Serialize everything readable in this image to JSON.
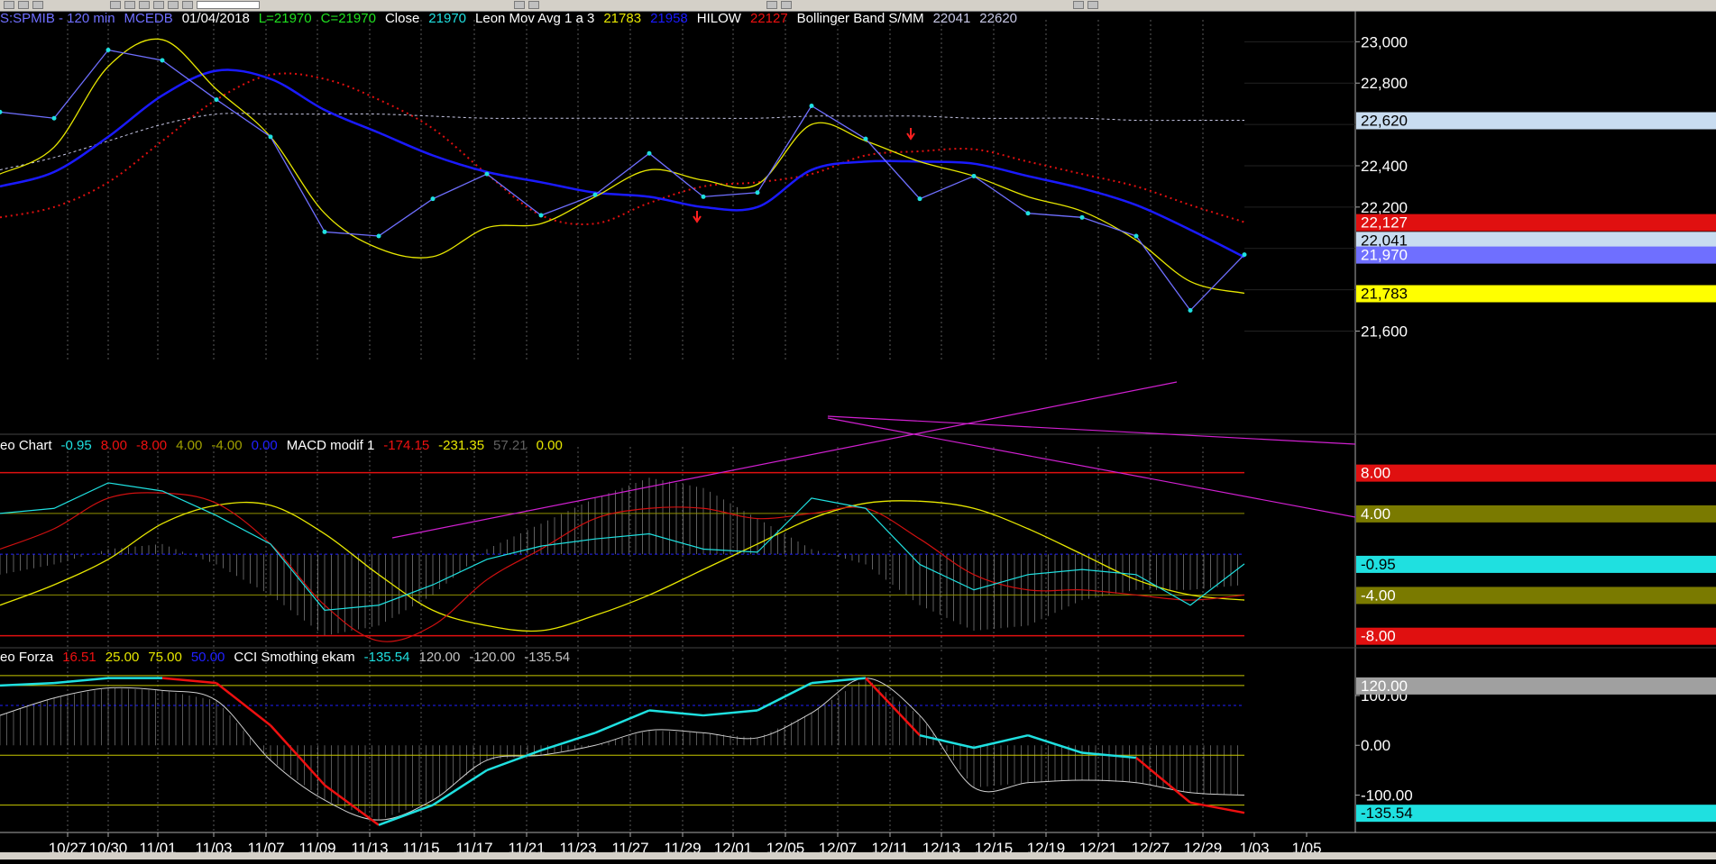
{
  "colors": {
    "grid": "#5a5a5a",
    "close": "#6f6fff",
    "close_dots": "#1fe0e0",
    "mov_avg_yellow": "#e6e600",
    "mov_avg_blue": "#1a1aff",
    "hilow_red": "#e01010",
    "hilow_green": "#14c814",
    "bollinger": "#c8c8e6",
    "macd_cyan": "#1fe0e0",
    "macd_red": "#d01010",
    "macd_yellow": "#e6e600",
    "magenta": "#d020d0",
    "histogram": "#a0a0a0",
    "cci_cyan": "#1fe0e0",
    "cci_red": "#ee1010",
    "cci_white": "#d0d0d0"
  },
  "panel1": {
    "header": [
      {
        "text": "S:SPMIB - 120 min",
        "color": "#6f6fff"
      },
      {
        "text": "MCEDB",
        "color": "#6f6fff"
      },
      {
        "text": "01/04/2018",
        "color": "#ffffff"
      },
      {
        "text": "L=21970",
        "color": "#20e020"
      },
      {
        "text": "C=21970",
        "color": "#20e020"
      },
      {
        "text": "Close",
        "color": "#ffffff"
      },
      {
        "text": "21970",
        "color": "#1fe0e0"
      },
      {
        "text": "Leon Mov Avg 1 a 3",
        "color": "#ffffff"
      },
      {
        "text": "21783",
        "color": "#e6e600"
      },
      {
        "text": "21958",
        "color": "#1a1aff"
      },
      {
        "text": "HILOW",
        "color": "#ffffff"
      },
      {
        "text": "22127",
        "color": "#ee1010"
      },
      {
        "text": "Bollinger Band S/MM",
        "color": "#ffffff"
      },
      {
        "text": "22041",
        "color": "#c8c8e6"
      },
      {
        "text": "22620",
        "color": "#c8c8e6"
      }
    ],
    "y_ticks": [
      "23,000",
      "22,800",
      "22,400",
      "22,200",
      "21,600"
    ],
    "value_tags": [
      {
        "text": "22,620",
        "bg": "#c8dcf0",
        "fg": "#000000"
      },
      {
        "text": "22,127",
        "bg": "#e01010",
        "fg": "#ffffff"
      },
      {
        "text": "22,041",
        "bg": "#c8dcf0",
        "fg": "#000000"
      },
      {
        "text": "21,970",
        "bg": "#6f6fff",
        "fg": "#ffffff"
      },
      {
        "text": "21,783",
        "bg": "#ffff00",
        "fg": "#000000"
      }
    ]
  },
  "panel2": {
    "header": [
      {
        "text": "eo Chart",
        "color": "#ffffff"
      },
      {
        "text": "-0.95",
        "color": "#1fe0e0"
      },
      {
        "text": "8.00",
        "color": "#ee1010"
      },
      {
        "text": "-8.00",
        "color": "#ee1010"
      },
      {
        "text": "4.00",
        "color": "#a0a000"
      },
      {
        "text": "-4.00",
        "color": "#a0a000"
      },
      {
        "text": "0.00",
        "color": "#2020ff"
      },
      {
        "text": "MACD modif 1",
        "color": "#ffffff"
      },
      {
        "text": "-174.15",
        "color": "#ee1010"
      },
      {
        "text": "-231.35",
        "color": "#e6e600"
      },
      {
        "text": "57.21",
        "color": "#606060"
      },
      {
        "text": "0.00",
        "color": "#e6e600"
      }
    ],
    "value_tags": [
      {
        "text": "8.00",
        "bg": "#e01010",
        "fg": "#ffffff"
      },
      {
        "text": "4.00",
        "bg": "#7a7a00",
        "fg": "#ffffff"
      },
      {
        "text": "-0.95",
        "bg": "#1fe0e0",
        "fg": "#000000"
      },
      {
        "text": "-4.00",
        "bg": "#7a7a00",
        "fg": "#ffffff"
      },
      {
        "text": "-8.00",
        "bg": "#e01010",
        "fg": "#ffffff"
      }
    ]
  },
  "panel3": {
    "header": [
      {
        "text": "eo Forza",
        "color": "#ffffff"
      },
      {
        "text": "16.51",
        "color": "#ee1010"
      },
      {
        "text": "25.00",
        "color": "#e6e600"
      },
      {
        "text": "75.00",
        "color": "#e6e600"
      },
      {
        "text": "50.00",
        "color": "#2020ff"
      },
      {
        "text": "CCI Smothing ekam",
        "color": "#ffffff"
      },
      {
        "text": "-135.54",
        "color": "#1fe0e0"
      },
      {
        "text": "120.00",
        "color": "#c0c0c0"
      },
      {
        "text": "-120.00",
        "color": "#c0c0c0"
      },
      {
        "text": "-135.54",
        "color": "#c0c0c0"
      }
    ],
    "y_ticks": [
      "100.00",
      "0.00",
      "-100.00"
    ],
    "value_tags": [
      {
        "text": "120.00",
        "bg": "#a0a0a0",
        "fg": "#ffffff"
      },
      {
        "text": "-135.54",
        "bg": "#1fe0e0",
        "fg": "#000000"
      }
    ]
  },
  "x_labels": [
    "10/27",
    "10/30",
    "11/01",
    "11/03",
    "11/07",
    "11/09",
    "11/13",
    "11/15",
    "11/17",
    "11/21",
    "11/23",
    "11/27",
    "11/29",
    "12/01",
    "12/05",
    "12/07",
    "12/11",
    "12/13",
    "12/15",
    "12/19",
    "12/21",
    "12/27",
    "12/29",
    "1/03",
    "1/05"
  ],
  "chart_data": [
    {
      "type": "line",
      "title": "S:SPMIB - 120 min",
      "categories": [
        "10/27",
        "10/30",
        "11/01",
        "11/03",
        "11/07",
        "11/09",
        "11/13",
        "11/15",
        "11/17",
        "11/21",
        "11/23",
        "11/27",
        "11/29",
        "12/01",
        "12/05",
        "12/07",
        "12/11",
        "12/13",
        "12/15",
        "12/19",
        "12/21",
        "12/27",
        "12/29",
        "1/03"
      ],
      "ylim": [
        21480,
        23080
      ],
      "series": [
        {
          "name": "Close",
          "values": [
            22660,
            22630,
            22960,
            22910,
            22720,
            22540,
            22080,
            22060,
            22240,
            22360,
            22160,
            22260,
            22460,
            22250,
            22270,
            22690,
            22530,
            22240,
            22350,
            22170,
            22150,
            22060,
            21700,
            21970
          ]
        },
        {
          "name": "Leon Mov Avg 1 a 3",
          "values": [
            22360,
            22490,
            22880,
            23010,
            22770,
            22540,
            22170,
            22000,
            21960,
            22100,
            22120,
            22250,
            22380,
            22330,
            22310,
            22600,
            22520,
            22420,
            22350,
            22250,
            22180,
            22040,
            21840,
            21783
          ]
        },
        {
          "name": "21958",
          "values": [
            22300,
            22370,
            22540,
            22740,
            22860,
            22820,
            22670,
            22560,
            22450,
            22370,
            22320,
            22270,
            22250,
            22200,
            22200,
            22380,
            22420,
            22420,
            22410,
            22350,
            22290,
            22210,
            22090,
            21958
          ]
        },
        {
          "name": "HILOW",
          "values": [
            22150,
            22200,
            22320,
            22520,
            22720,
            22840,
            22820,
            22720,
            22580,
            22360,
            22160,
            22120,
            22220,
            22300,
            22320,
            22360,
            22450,
            22470,
            22480,
            22420,
            22360,
            22300,
            22210,
            22127
          ]
        },
        {
          "name": "Bollinger Band S/MM",
          "values": [
            22380,
            22440,
            22520,
            22600,
            22650,
            22650,
            22650,
            22650,
            22640,
            22630,
            22630,
            22630,
            22630,
            22630,
            22630,
            22640,
            22640,
            22640,
            22630,
            22630,
            22630,
            22620,
            22620,
            22620
          ]
        }
      ]
    },
    {
      "type": "line",
      "title": "MACD modif 1",
      "categories": [
        "10/27",
        "10/30",
        "11/01",
        "11/03",
        "11/07",
        "11/09",
        "11/13",
        "11/15",
        "11/17",
        "11/21",
        "11/23",
        "11/27",
        "11/29",
        "12/01",
        "12/05",
        "12/07",
        "12/11",
        "12/13",
        "12/15",
        "12/19",
        "12/21",
        "12/27",
        "12/29",
        "1/03"
      ],
      "ylim": [
        -9,
        10
      ],
      "series": [
        {
          "name": "-0.95",
          "values": [
            4.0,
            4.5,
            7.0,
            6.2,
            3.8,
            1.0,
            -5.5,
            -5.0,
            -3.0,
            -0.5,
            0.8,
            1.5,
            2.0,
            0.5,
            0.2,
            5.5,
            4.5,
            -1.0,
            -3.5,
            -2.0,
            -1.5,
            -2.0,
            -5.0,
            -0.95
          ]
        },
        {
          "name": "-174.15",
          "values": [
            0.5,
            2.5,
            5.5,
            6.0,
            5.0,
            1.0,
            -5.0,
            -8.5,
            -7.0,
            -2.5,
            0.5,
            3.5,
            4.5,
            4.5,
            3.5,
            4.0,
            4.5,
            1.5,
            -2.0,
            -3.5,
            -3.5,
            -4.0,
            -4.5,
            -4.0
          ]
        },
        {
          "name": "-231.35",
          "values": [
            -5.0,
            -3.0,
            -0.5,
            3.0,
            4.8,
            4.8,
            2.0,
            -2.0,
            -5.5,
            -7.0,
            -7.5,
            -6.0,
            -4.0,
            -1.5,
            1.0,
            3.5,
            5.0,
            5.2,
            4.5,
            2.5,
            0.0,
            -2.5,
            -4.0,
            -4.5
          ]
        },
        {
          "name": "57.21",
          "values": [
            -2.0,
            -1.0,
            0.5,
            1.0,
            -1.0,
            -4.0,
            -8.0,
            -7.0,
            -4.0,
            0.5,
            3.0,
            5.5,
            7.5,
            6.5,
            3.5,
            0.5,
            -1.0,
            -5.0,
            -7.5,
            -7.0,
            -4.5,
            -3.5,
            -3.5,
            -3.0
          ]
        }
      ]
    },
    {
      "type": "line",
      "title": "CCI Smothing ekam",
      "categories": [
        "10/27",
        "10/30",
        "11/01",
        "11/03",
        "11/07",
        "11/09",
        "11/13",
        "11/15",
        "11/17",
        "11/21",
        "11/23",
        "11/27",
        "11/29",
        "12/01",
        "12/05",
        "12/07",
        "12/11",
        "12/13",
        "12/15",
        "12/19",
        "12/21",
        "12/27",
        "12/29",
        "1/03"
      ],
      "ylim": [
        -175,
        165
      ],
      "series": [
        {
          "name": "-135.54",
          "values": [
            120,
            125,
            135,
            135,
            125,
            40,
            -80,
            -160,
            -120,
            -50,
            -10,
            25,
            70,
            60,
            70,
            125,
            135,
            20,
            -5,
            20,
            -15,
            -25,
            -115,
            -135.54
          ]
        },
        {
          "name": "120.00",
          "values": [
            60,
            95,
            115,
            110,
            90,
            -30,
            -110,
            -150,
            -110,
            -30,
            -20,
            0,
            30,
            25,
            15,
            65,
            135,
            60,
            -85,
            -75,
            -70,
            -75,
            -95,
            -100
          ]
        }
      ]
    }
  ]
}
